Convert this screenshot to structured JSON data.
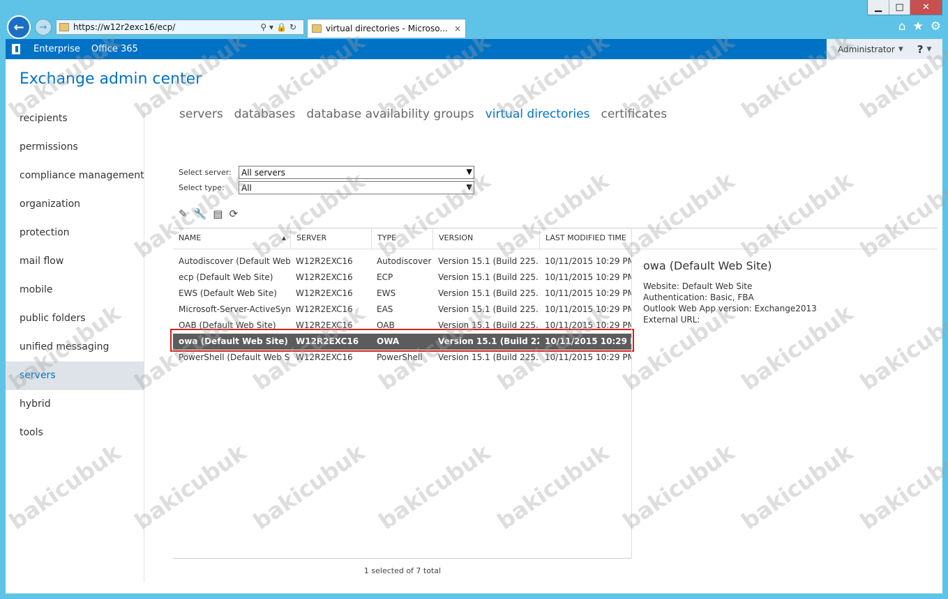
{
  "window": {
    "minimize": "▁",
    "maximize": "□",
    "close": "✕"
  },
  "browser": {
    "url": "https://w12r2exc16/ecp/",
    "tab_title": "virtual directories - Microso...",
    "tab_close": "×"
  },
  "topbar": {
    "links": [
      "Enterprise",
      "Office 365"
    ],
    "user": "Administrator",
    "help": "?"
  },
  "app_title": "Exchange admin center",
  "sidebar": {
    "items": [
      {
        "label": "recipients"
      },
      {
        "label": "permissions"
      },
      {
        "label": "compliance management"
      },
      {
        "label": "organization"
      },
      {
        "label": "protection"
      },
      {
        "label": "mail flow"
      },
      {
        "label": "mobile"
      },
      {
        "label": "public folders"
      },
      {
        "label": "unified messaging"
      },
      {
        "label": "servers",
        "active": true
      },
      {
        "label": "hybrid"
      },
      {
        "label": "tools"
      }
    ]
  },
  "subtabs": [
    "servers",
    "databases",
    "database availability groups",
    "virtual directories",
    "certificates"
  ],
  "active_subtab": "virtual directories",
  "filters": {
    "server_label": "Select server:",
    "server_value": "All servers",
    "type_label": "Select type:",
    "type_value": "All"
  },
  "toolbar_icons": [
    "edit-icon",
    "wrench-icon",
    "reset-icon",
    "refresh-icon"
  ],
  "table": {
    "columns": [
      "NAME",
      "SERVER",
      "TYPE",
      "VERSION",
      "LAST MODIFIED TIME"
    ],
    "rows": [
      [
        "Autodiscover (Default Web...",
        "W12R2EXC16",
        "Autodiscover",
        "Version 15.1 (Build 225....",
        "10/11/2015 10:29 PM"
      ],
      [
        "ecp (Default Web Site)",
        "W12R2EXC16",
        "ECP",
        "Version 15.1 (Build 225....",
        "10/11/2015 10:29 PM"
      ],
      [
        "EWS (Default Web Site)",
        "W12R2EXC16",
        "EWS",
        "Version 15.1 (Build 225....",
        "10/11/2015 10:29 PM"
      ],
      [
        "Microsoft-Server-ActiveSyn...",
        "W12R2EXC16",
        "EAS",
        "Version 15.1 (Build 225....",
        "10/11/2015 10:29 PM"
      ],
      [
        "OAB (Default Web Site)",
        "W12R2EXC16",
        "OAB",
        "Version 15.1 (Build 225....",
        "10/11/2015 10:29 PM"
      ],
      [
        "owa (Default Web Site)",
        "W12R2EXC16",
        "OWA",
        "Version 15.1 (Build 225....",
        "10/11/2015 10:29 P..."
      ],
      [
        "PowerShell (Default Web Si...",
        "W12R2EXC16",
        "PowerShell",
        "Version 15.1 (Build 225....",
        "10/11/2015 10:29 PM"
      ]
    ],
    "selected_index": 5
  },
  "details": {
    "title": "owa (Default Web Site)",
    "lines": [
      "Website: Default Web Site",
      "Authentication: Basic, FBA",
      "Outlook Web App version: Exchange2013",
      "External URL:"
    ]
  },
  "status": "1 selected of 7 total",
  "watermark": "bakicubuk"
}
